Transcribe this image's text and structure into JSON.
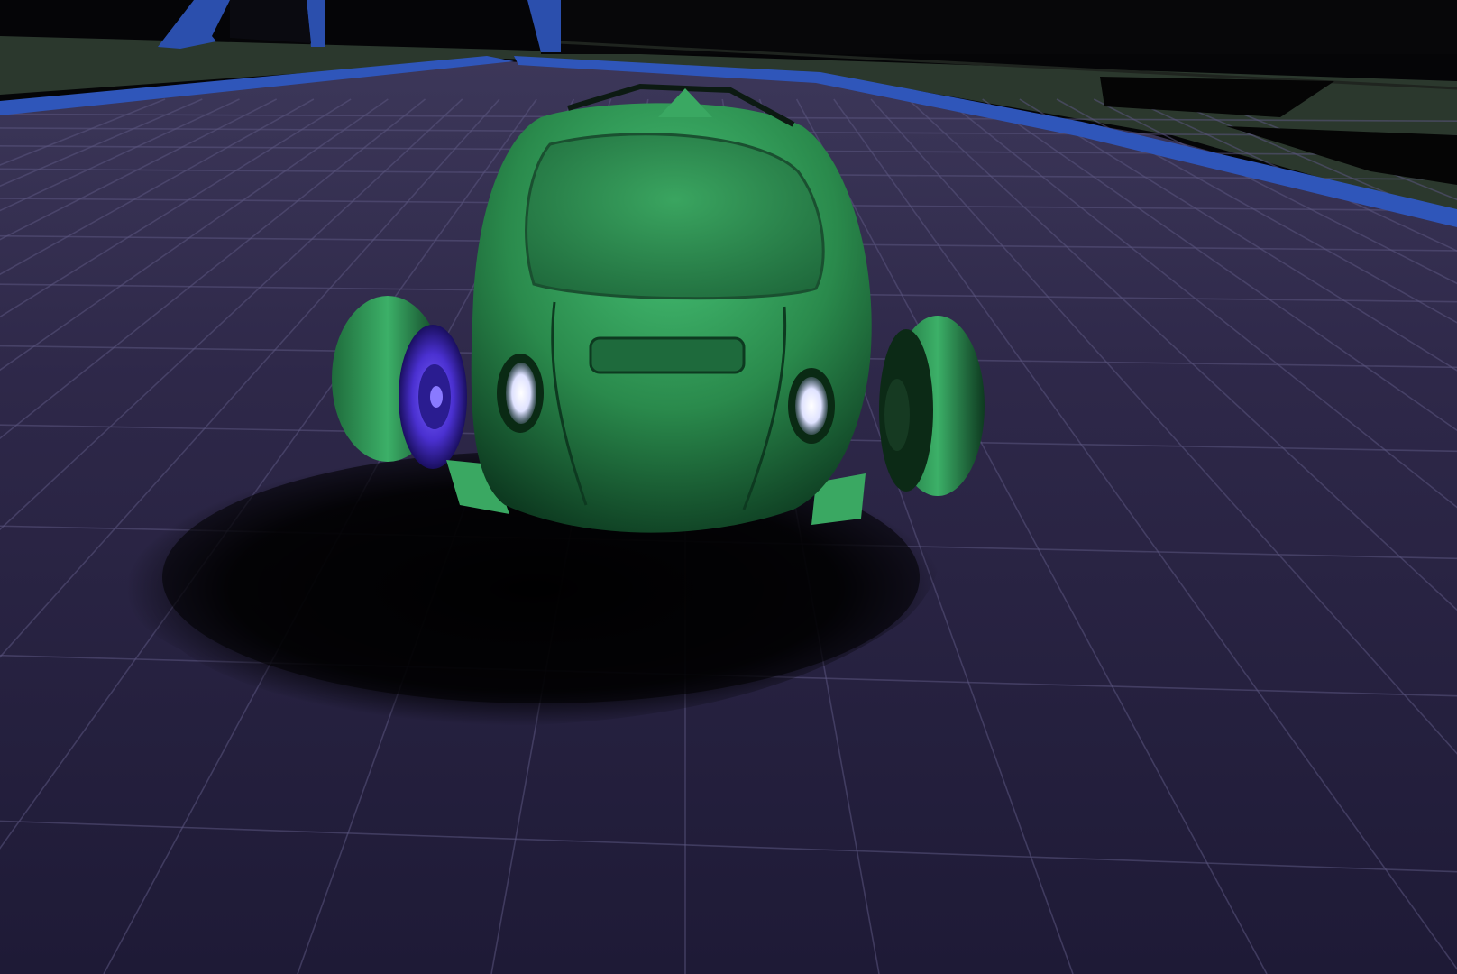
{
  "scene": {
    "kind": "3d-game-viewport",
    "subject": "green-buggy-car",
    "environment": "arena-floor-grid",
    "colors": {
      "floor": "#272142",
      "floor_far": "#3a3558",
      "grid_line": "#5b5680",
      "curb": "#2f55b8",
      "grass": "#2c3a2e",
      "sky": "#050507",
      "car_body": "#2f9a55",
      "car_highlight": "#4fd07e",
      "car_shadow": "#0c2a18",
      "wheel_rim": "#4630c8",
      "headlight": "#f4f4ff",
      "ramp": "#2a4ea8"
    }
  }
}
